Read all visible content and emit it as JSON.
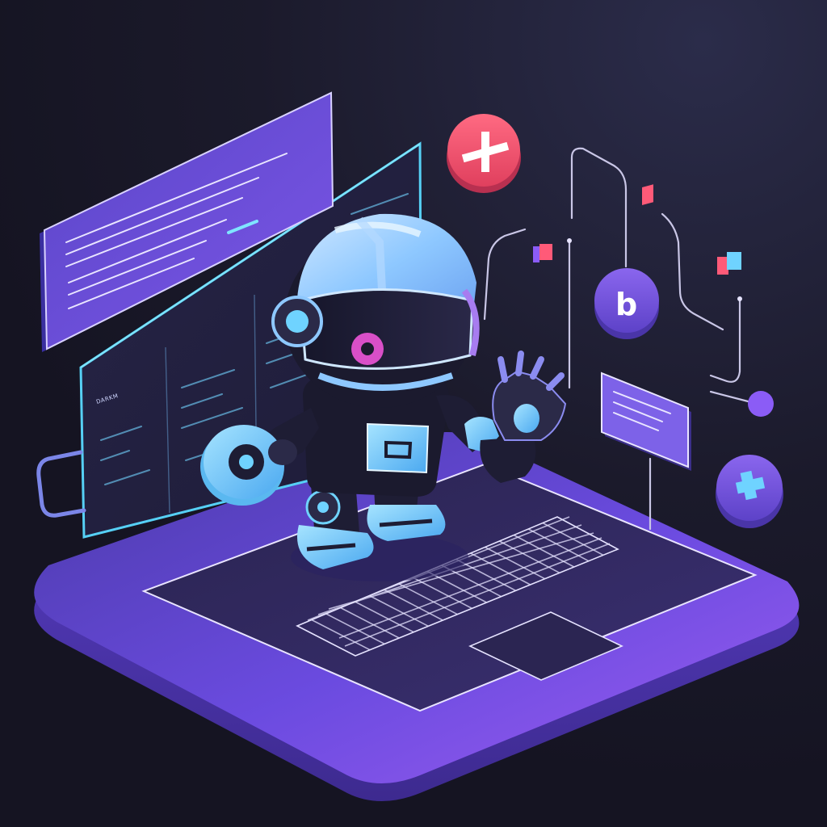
{
  "scene": {
    "description_label": "",
    "window_label": "DARKM",
    "badge_b_glyph": "b"
  },
  "icons": {
    "plus_badge": "plus-icon",
    "b_badge": "letter-b-icon",
    "cross_badge": "cross-icon"
  },
  "colors": {
    "background": "#1b1a2b",
    "platform": "#6a4fd8",
    "accent_cyan": "#6fd3ff",
    "accent_pink": "#ff5a78",
    "accent_purple": "#8b5cf6"
  }
}
